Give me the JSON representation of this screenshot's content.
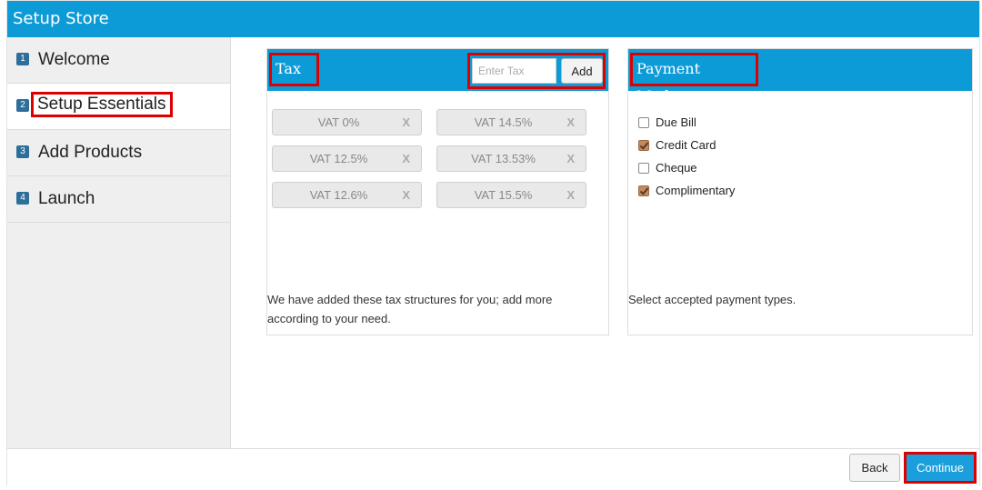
{
  "app": {
    "title": "Setup Store"
  },
  "sidebar": {
    "steps": [
      {
        "num": "1",
        "label": "Welcome"
      },
      {
        "num": "2",
        "label": "Setup Essentials"
      },
      {
        "num": "3",
        "label": "Add Products"
      },
      {
        "num": "4",
        "label": "Launch"
      }
    ],
    "active_step": "Setup Essentials"
  },
  "tax": {
    "title": "Tax",
    "input_placeholder": "Enter Tax",
    "add_label": "Add",
    "items": [
      "VAT 0%",
      "VAT 14.5%",
      "VAT 12.5%",
      "VAT 13.53%",
      "VAT 12.6%",
      "VAT 15.5%"
    ],
    "remove_label": "X",
    "note": "We have added these tax structures for you; add more according to your need."
  },
  "payment": {
    "title": "Payment Modes",
    "modes": [
      {
        "label": "Due Bill",
        "checked": false
      },
      {
        "label": "Credit Card",
        "checked": true
      },
      {
        "label": "Cheque",
        "checked": false
      },
      {
        "label": "Complimentary",
        "checked": true
      }
    ],
    "note": "Select accepted payment types."
  },
  "footer": {
    "back_label": "Back",
    "continue_label": "Continue"
  },
  "colors": {
    "header_blue": "#0d9bd8",
    "highlight_red": "#dd0000",
    "checkbox_checked": "#c28a62"
  }
}
